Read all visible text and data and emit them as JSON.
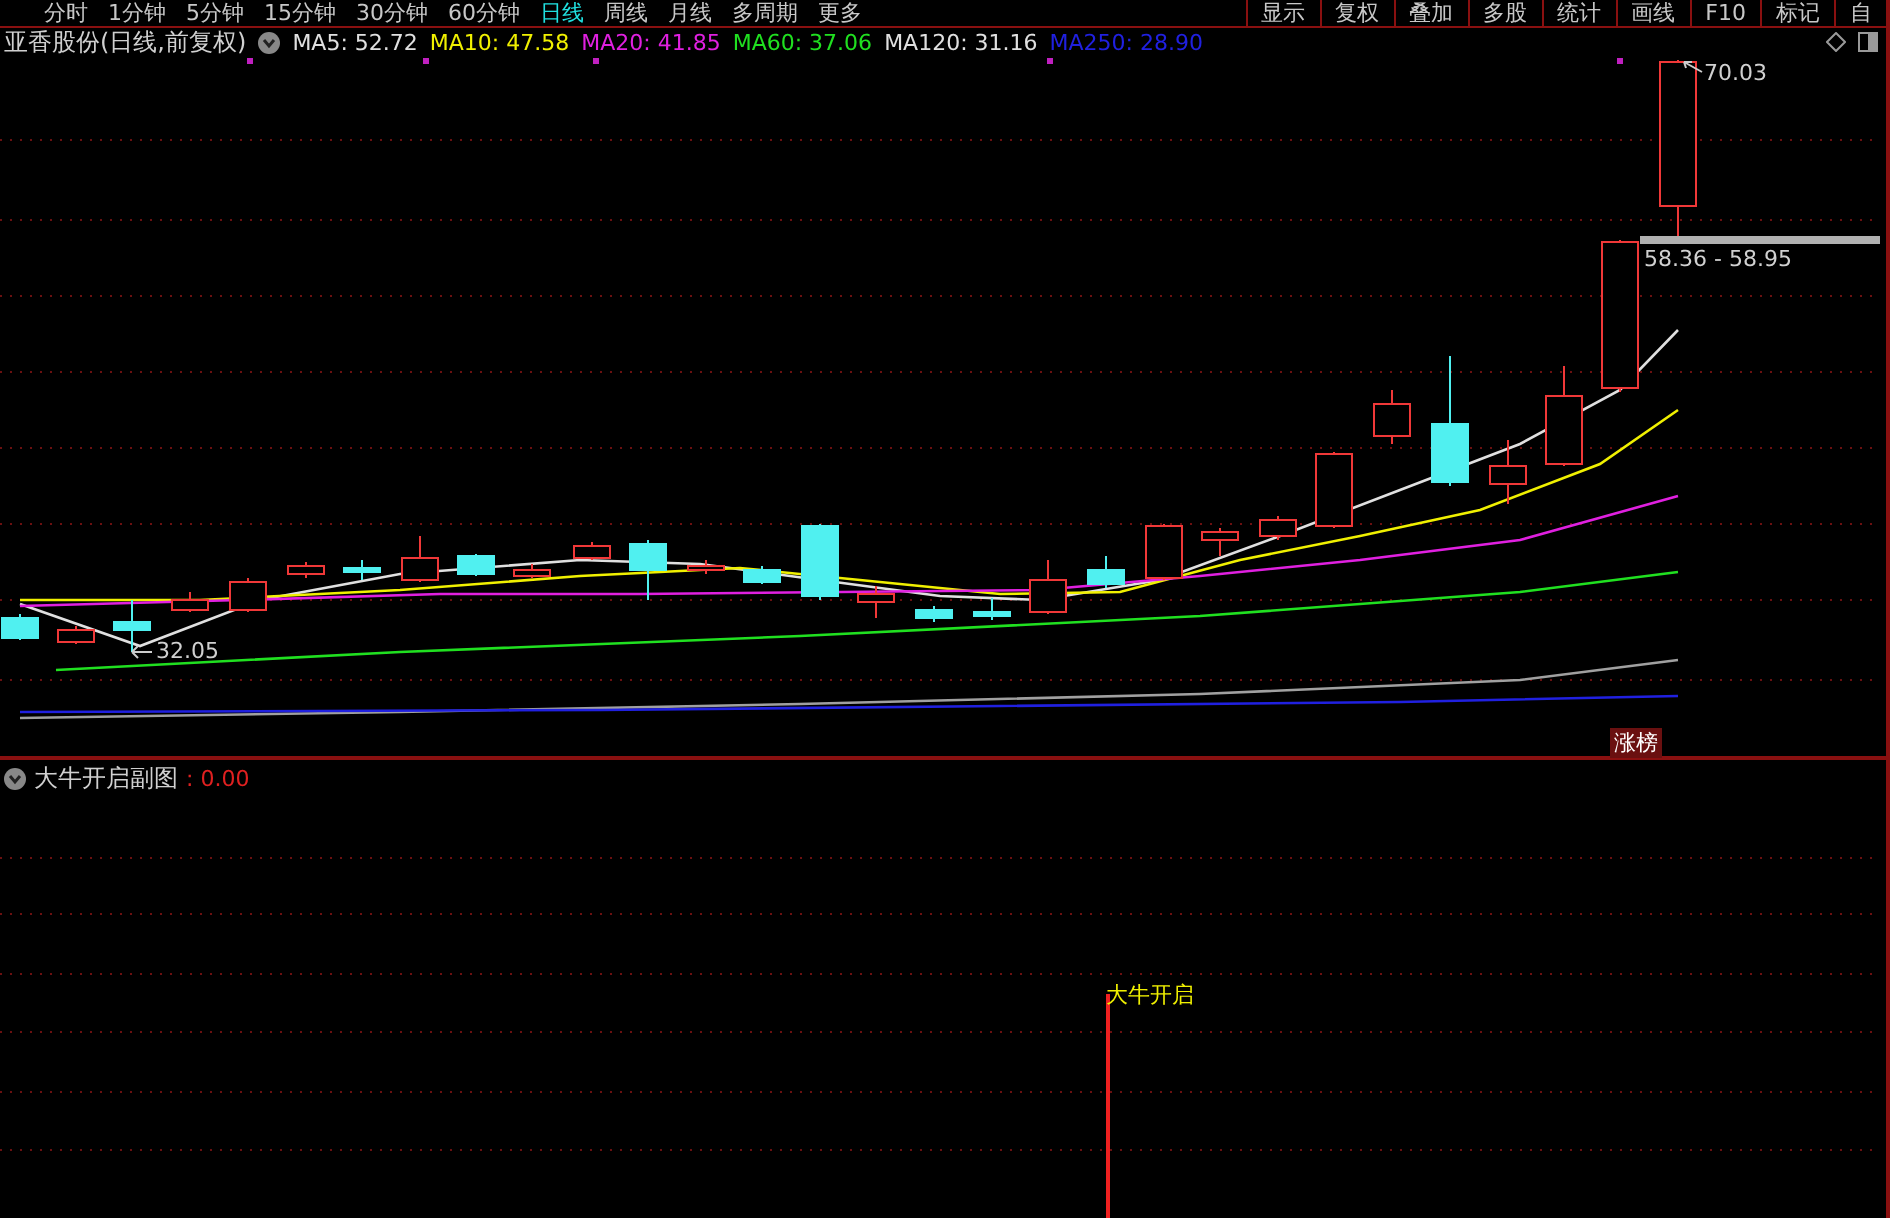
{
  "toolbar": {
    "periods": [
      {
        "label": "分时",
        "selected": false
      },
      {
        "label": "1分钟",
        "selected": false
      },
      {
        "label": "5分钟",
        "selected": false
      },
      {
        "label": "15分钟",
        "selected": false
      },
      {
        "label": "30分钟",
        "selected": false
      },
      {
        "label": "60分钟",
        "selected": false
      },
      {
        "label": "日线",
        "selected": true
      },
      {
        "label": "周线",
        "selected": false
      },
      {
        "label": "月线",
        "selected": false
      },
      {
        "label": "多周期",
        "selected": false
      },
      {
        "label": "更多",
        "selected": false
      }
    ],
    "buttons": [
      "显示",
      "复权",
      "叠加",
      "多股",
      "统计",
      "画线",
      "F10",
      "标记",
      "自"
    ]
  },
  "main_chart": {
    "title": "亚香股份(日线,前复权)",
    "indicators": [
      {
        "label": "MA5: 52.72",
        "color": "#e0e0e0"
      },
      {
        "label": "MA10: 47.58",
        "color": "#f0f000"
      },
      {
        "label": "MA20: 41.85",
        "color": "#e020e0"
      },
      {
        "label": "MA60: 37.06",
        "color": "#20e020"
      },
      {
        "label": "MA120: 31.16",
        "color": "#e0e0e0"
      },
      {
        "label": "MA250: 28.90",
        "color": "#2020e0"
      }
    ],
    "high_label": "70.03",
    "low_label": "32.05",
    "range_label": "58.36 - 58.95",
    "badge": "涨榜"
  },
  "sub_chart": {
    "title": "大牛开启副图",
    "value": ": 0.00",
    "signal_label": "大牛开启"
  }
}
